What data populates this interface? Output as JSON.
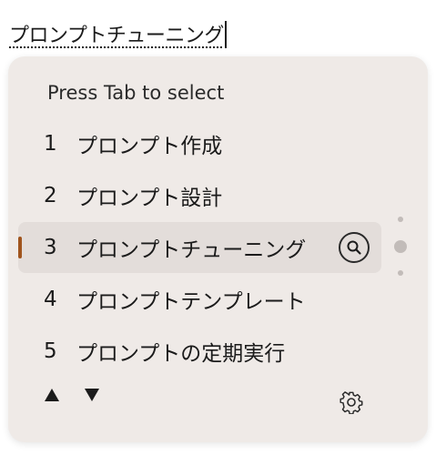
{
  "composition": {
    "text": "プロンプトチューニング"
  },
  "panel": {
    "hint": "Press Tab to select",
    "selected_index": 2,
    "candidates": [
      {
        "number": "1",
        "label": "プロンプト作成"
      },
      {
        "number": "2",
        "label": "プロンプト設計"
      },
      {
        "number": "3",
        "label": "プロンプトチューニング"
      },
      {
        "number": "4",
        "label": "プロンプトテンプレート"
      },
      {
        "number": "5",
        "label": "プロンプトの定期実行"
      }
    ],
    "icons": {
      "lookup": "search-icon",
      "prev": "triangle-up-icon",
      "next": "triangle-down-icon",
      "settings": "gear-icon"
    }
  },
  "colors": {
    "panel_background": "#efeae7",
    "selected_background": "#e3ddda",
    "selection_indicator": "#a0541d"
  }
}
